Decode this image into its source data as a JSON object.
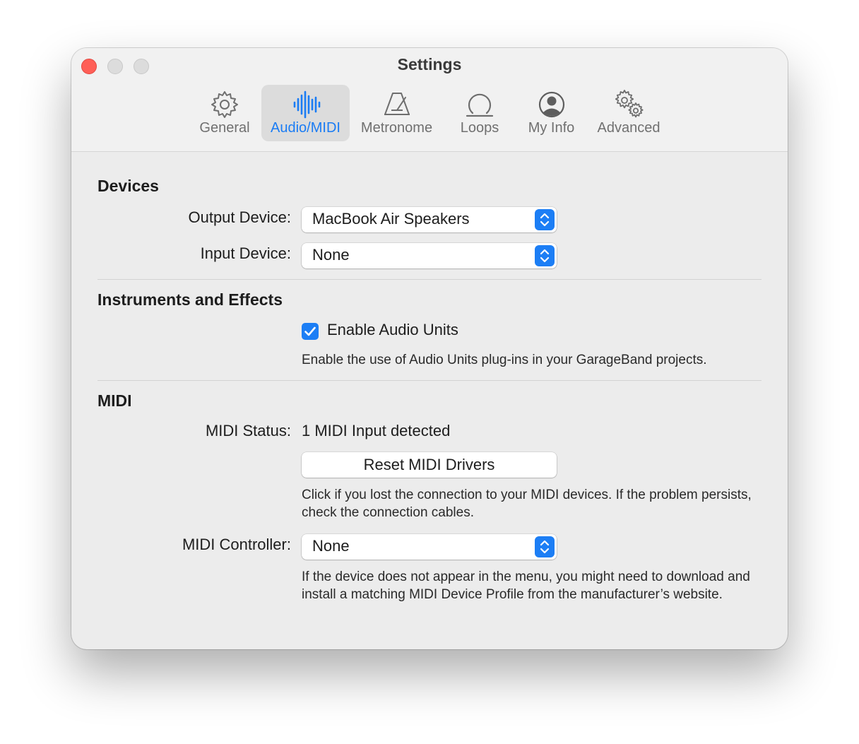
{
  "window": {
    "title": "Settings"
  },
  "toolbar": {
    "items": [
      {
        "label": "General",
        "icon": "gear-icon",
        "active": false
      },
      {
        "label": "Audio/MIDI",
        "icon": "waveform-icon",
        "active": true
      },
      {
        "label": "Metronome",
        "icon": "metronome-icon",
        "active": false
      },
      {
        "label": "Loops",
        "icon": "loop-icon",
        "active": false
      },
      {
        "label": "My Info",
        "icon": "person-circle-icon",
        "active": false
      },
      {
        "label": "Advanced",
        "icon": "gears-icon",
        "active": false
      }
    ]
  },
  "devices": {
    "title": "Devices",
    "output_label": "Output Device:",
    "output_value": "MacBook Air Speakers",
    "input_label": "Input Device:",
    "input_value": "None"
  },
  "instruments": {
    "title": "Instruments and Effects",
    "enable_audio_units_label": "Enable Audio Units",
    "enable_audio_units_checked": true,
    "description": "Enable the use of Audio Units plug-ins in your GarageBand projects."
  },
  "midi": {
    "title": "MIDI",
    "status_label": "MIDI Status:",
    "status_value": "1 MIDI Input detected",
    "reset_button": "Reset MIDI Drivers",
    "reset_help": "Click if you lost the connection to your MIDI devices. If the problem persists, check the connection cables.",
    "controller_label": "MIDI Controller:",
    "controller_value": "None",
    "controller_help": "If the device does not appear in the menu, you might need to download and install a matching MIDI Device Profile from the manufacturer’s website."
  },
  "colors": {
    "accent": "#1c7ef5",
    "close_button": "#ff5f57",
    "window_background": "#ececec"
  }
}
